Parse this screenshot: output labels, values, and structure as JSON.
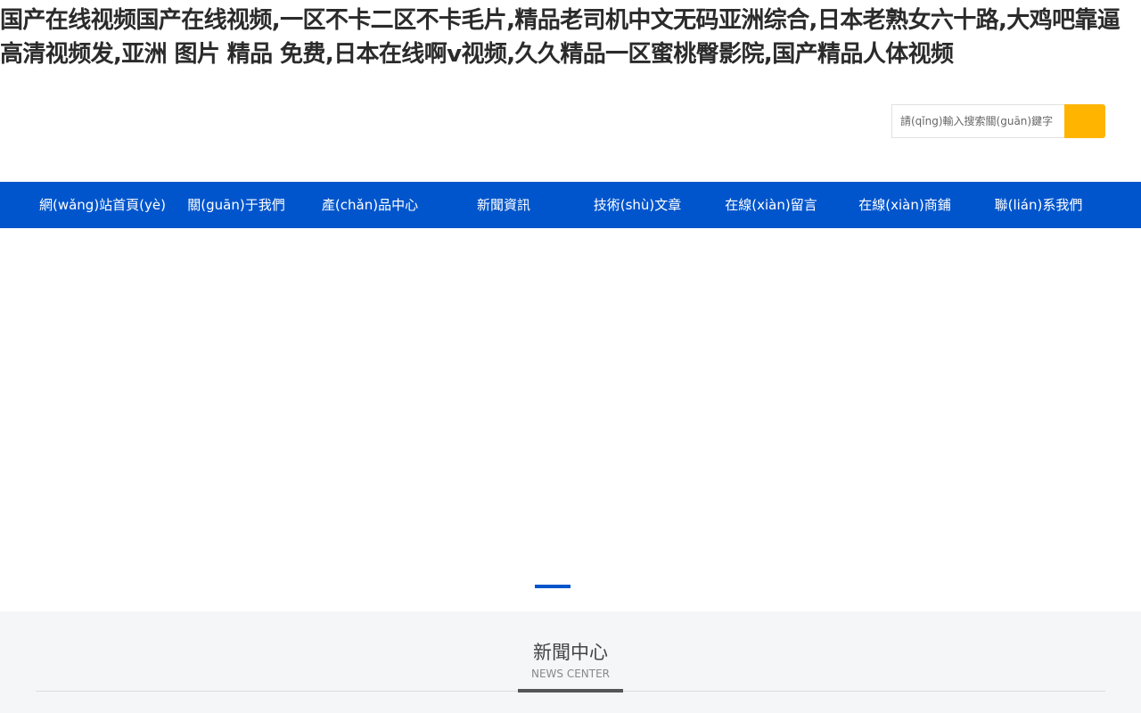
{
  "header": {
    "headline": "国产在线视频国产在线视频,一区不卡二区不卡毛片,精品老司机中文无码亚洲综合,日本老熟女六十路,大鸡吧靠逼高清视频发,亚洲 图片 精品 免费,日本在线啊v视频,久久精品一区蜜桃臀影院,国产精品人体视频"
  },
  "search": {
    "placeholder": "請(qǐng)輸入搜索關(guān)鍵字",
    "button_color": "#ffb400"
  },
  "nav": {
    "background": "#0055cc",
    "items": [
      {
        "label": "網(wǎng)站首頁(yè)"
      },
      {
        "label": "關(guān)于我們"
      },
      {
        "label": "產(chǎn)品中心"
      },
      {
        "label": "新聞資訊"
      },
      {
        "label": "技術(shù)文章"
      },
      {
        "label": "在線(xiàn)留言"
      },
      {
        "label": "在線(xiàn)商鋪"
      },
      {
        "label": "聯(lián)系我們"
      }
    ]
  },
  "news": {
    "title": "新聞中心",
    "subtitle": "NEWS CENTER"
  }
}
